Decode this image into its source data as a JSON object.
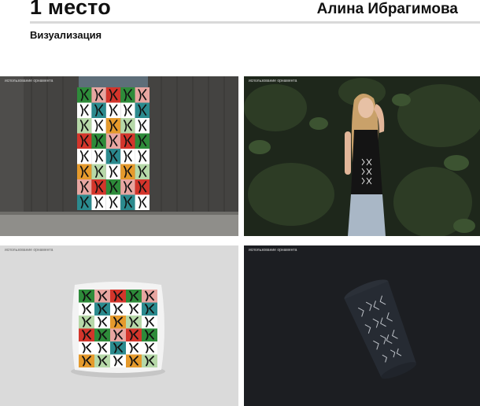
{
  "header": {
    "title": "1 место",
    "author": "Алина Ибрагимова",
    "subtitle": "Визуализация"
  },
  "panels": [
    {
      "caption": "использование орнамента",
      "subject": "building-facade-banner"
    },
    {
      "caption": "использование орнамента",
      "subject": "model-in-ornament-tank-top"
    },
    {
      "caption": "использование орнамента",
      "subject": "ornament-pillow"
    },
    {
      "caption": "использование орнамента",
      "subject": "ornament-paper-cup"
    }
  ],
  "palette": {
    "green": "#2e8b3a",
    "teal": "#2b8a8e",
    "orange": "#e59a2c",
    "red": "#d3352b",
    "pink": "#e8a6a1",
    "light_green": "#b6d8a8",
    "ink": "#111111"
  }
}
